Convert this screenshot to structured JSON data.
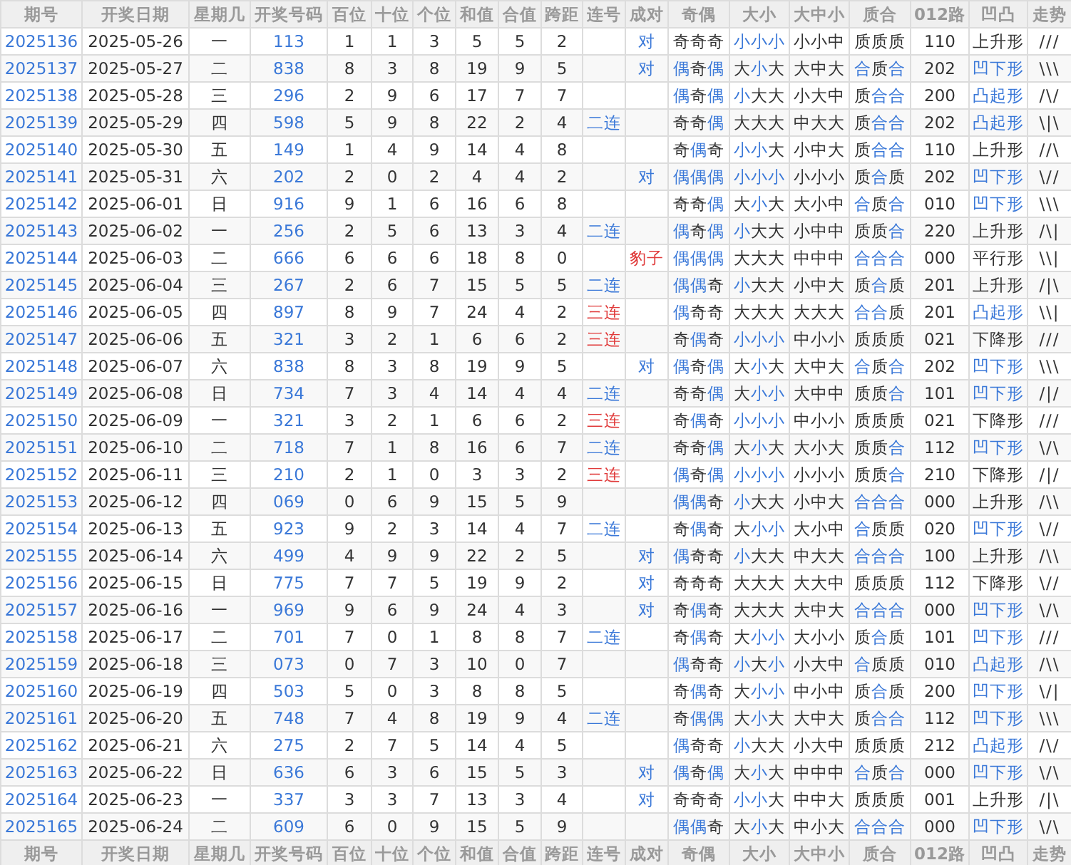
{
  "columns": [
    "期号",
    "开奖日期",
    "星期几",
    "开奖号码",
    "百位",
    "十位",
    "个位",
    "和值",
    "合值",
    "跨距",
    "连号",
    "成对",
    "奇偶",
    "大小",
    "大中小",
    "质合",
    "012路",
    "凹凸",
    "走势"
  ],
  "rows": [
    {
      "issue": "2025136",
      "date": "2025-05-26",
      "weekday": "一",
      "number": "113",
      "hundreds": "1",
      "tens": "1",
      "units": "3",
      "sum": "5",
      "sum_tail": "5",
      "span": "2",
      "pair": {
        "text": "对",
        "color": "#3a78d8"
      },
      "parity": {
        "text": "奇奇奇",
        "highlighted": [
          false,
          false,
          false
        ]
      },
      "size": {
        "text": "小小小",
        "highlighted": [
          true,
          true,
          true
        ]
      },
      "size3": "小小中",
      "prime": {
        "text": "质质质",
        "highlighted": [
          false,
          false,
          false
        ]
      },
      "road": "110",
      "shape": {
        "text": "上升形",
        "highlighted": false
      },
      "trend": "///"
    },
    {
      "issue": "2025137",
      "date": "2025-05-27",
      "weekday": "二",
      "number": "838",
      "hundreds": "8",
      "tens": "3",
      "units": "8",
      "sum": "19",
      "sum_tail": "9",
      "span": "5",
      "pair": {
        "text": "对",
        "color": "#3a78d8"
      },
      "parity": {
        "text": "偶奇偶",
        "highlighted": [
          true,
          false,
          true
        ]
      },
      "size": {
        "text": "大小大",
        "highlighted": [
          false,
          true,
          false
        ]
      },
      "size3": "大中大",
      "prime": {
        "text": "合质合",
        "highlighted": [
          true,
          false,
          true
        ]
      },
      "road": "202",
      "shape": {
        "text": "凹下形",
        "highlighted": true
      },
      "trend": "\\\\\\"
    },
    {
      "issue": "2025138",
      "date": "2025-05-28",
      "weekday": "三",
      "number": "296",
      "hundreds": "2",
      "tens": "9",
      "units": "6",
      "sum": "17",
      "sum_tail": "7",
      "span": "7",
      "parity": {
        "text": "偶奇偶",
        "highlighted": [
          true,
          false,
          true
        ]
      },
      "size": {
        "text": "小大大",
        "highlighted": [
          true,
          false,
          false
        ]
      },
      "size3": "小大中",
      "prime": {
        "text": "质合合",
        "highlighted": [
          false,
          true,
          true
        ]
      },
      "road": "200",
      "shape": {
        "text": "凸起形",
        "highlighted": true
      },
      "trend": "/\\/"
    },
    {
      "issue": "2025139",
      "date": "2025-05-29",
      "weekday": "四",
      "number": "598",
      "hundreds": "5",
      "tens": "9",
      "units": "8",
      "sum": "22",
      "sum_tail": "2",
      "span": "4",
      "consecutive": {
        "text": "二连",
        "color": "#3a78d8"
      },
      "parity": {
        "text": "奇奇偶",
        "highlighted": [
          false,
          false,
          true
        ]
      },
      "size": {
        "text": "大大大",
        "highlighted": [
          false,
          false,
          false
        ]
      },
      "size3": "中大大",
      "prime": {
        "text": "质合合",
        "highlighted": [
          false,
          true,
          true
        ]
      },
      "road": "202",
      "shape": {
        "text": "凸起形",
        "highlighted": true
      },
      "trend": "\\|\\"
    },
    {
      "issue": "2025140",
      "date": "2025-05-30",
      "weekday": "五",
      "number": "149",
      "hundreds": "1",
      "tens": "4",
      "units": "9",
      "sum": "14",
      "sum_tail": "4",
      "span": "8",
      "parity": {
        "text": "奇偶奇",
        "highlighted": [
          false,
          true,
          false
        ]
      },
      "size": {
        "text": "小小大",
        "highlighted": [
          true,
          true,
          false
        ]
      },
      "size3": "小中大",
      "prime": {
        "text": "质合合",
        "highlighted": [
          false,
          true,
          true
        ]
      },
      "road": "110",
      "shape": {
        "text": "上升形",
        "highlighted": false
      },
      "trend": "//\\"
    },
    {
      "issue": "2025141",
      "date": "2025-05-31",
      "weekday": "六",
      "number": "202",
      "hundreds": "2",
      "tens": "0",
      "units": "2",
      "sum": "4",
      "sum_tail": "4",
      "span": "2",
      "pair": {
        "text": "对",
        "color": "#3a78d8"
      },
      "parity": {
        "text": "偶偶偶",
        "highlighted": [
          true,
          true,
          true
        ]
      },
      "size": {
        "text": "小小小",
        "highlighted": [
          true,
          true,
          true
        ]
      },
      "size3": "小小小",
      "prime": {
        "text": "质合质",
        "highlighted": [
          false,
          true,
          false
        ]
      },
      "road": "202",
      "shape": {
        "text": "凹下形",
        "highlighted": true
      },
      "trend": "\\//"
    },
    {
      "issue": "2025142",
      "date": "2025-06-01",
      "weekday": "日",
      "number": "916",
      "hundreds": "9",
      "tens": "1",
      "units": "6",
      "sum": "16",
      "sum_tail": "6",
      "span": "8",
      "parity": {
        "text": "奇奇偶",
        "highlighted": [
          false,
          false,
          true
        ]
      },
      "size": {
        "text": "大小大",
        "highlighted": [
          false,
          true,
          false
        ]
      },
      "size3": "大小中",
      "prime": {
        "text": "合质合",
        "highlighted": [
          true,
          false,
          true
        ]
      },
      "road": "010",
      "shape": {
        "text": "凹下形",
        "highlighted": true
      },
      "trend": "\\\\\\"
    },
    {
      "issue": "2025143",
      "date": "2025-06-02",
      "weekday": "一",
      "number": "256",
      "hundreds": "2",
      "tens": "5",
      "units": "6",
      "sum": "13",
      "sum_tail": "3",
      "span": "4",
      "consecutive": {
        "text": "二连",
        "color": "#3a78d8"
      },
      "parity": {
        "text": "偶奇偶",
        "highlighted": [
          true,
          false,
          true
        ]
      },
      "size": {
        "text": "小大大",
        "highlighted": [
          true,
          false,
          false
        ]
      },
      "size3": "小中中",
      "prime": {
        "text": "质质合",
        "highlighted": [
          false,
          false,
          true
        ]
      },
      "road": "220",
      "shape": {
        "text": "上升形",
        "highlighted": false
      },
      "trend": "/\\|"
    },
    {
      "issue": "2025144",
      "date": "2025-06-03",
      "weekday": "二",
      "number": "666",
      "hundreds": "6",
      "tens": "6",
      "units": "6",
      "sum": "18",
      "sum_tail": "8",
      "span": "0",
      "pair": {
        "text": "豹子",
        "color": "#e03a3a"
      },
      "parity": {
        "text": "偶偶偶",
        "highlighted": [
          true,
          true,
          true
        ]
      },
      "size": {
        "text": "大大大",
        "highlighted": [
          false,
          false,
          false
        ]
      },
      "size3": "中中中",
      "prime": {
        "text": "合合合",
        "highlighted": [
          true,
          true,
          true
        ]
      },
      "road": "000",
      "shape": {
        "text": "平行形",
        "highlighted": false
      },
      "trend": "\\\\|"
    },
    {
      "issue": "2025145",
      "date": "2025-06-04",
      "weekday": "三",
      "number": "267",
      "hundreds": "2",
      "tens": "6",
      "units": "7",
      "sum": "15",
      "sum_tail": "5",
      "span": "5",
      "consecutive": {
        "text": "二连",
        "color": "#3a78d8"
      },
      "parity": {
        "text": "偶偶奇",
        "highlighted": [
          true,
          true,
          false
        ]
      },
      "size": {
        "text": "小大大",
        "highlighted": [
          true,
          false,
          false
        ]
      },
      "size3": "小中大",
      "prime": {
        "text": "质合质",
        "highlighted": [
          false,
          true,
          false
        ]
      },
      "road": "201",
      "shape": {
        "text": "上升形",
        "highlighted": false
      },
      "trend": "/|\\"
    },
    {
      "issue": "2025146",
      "date": "2025-06-05",
      "weekday": "四",
      "number": "897",
      "hundreds": "8",
      "tens": "9",
      "units": "7",
      "sum": "24",
      "sum_tail": "4",
      "span": "2",
      "consecutive": {
        "text": "三连",
        "color": "#e03a3a"
      },
      "parity": {
        "text": "偶奇奇",
        "highlighted": [
          true,
          false,
          false
        ]
      },
      "size": {
        "text": "大大大",
        "highlighted": [
          false,
          false,
          false
        ]
      },
      "size3": "大大大",
      "prime": {
        "text": "合合质",
        "highlighted": [
          true,
          true,
          false
        ]
      },
      "road": "201",
      "shape": {
        "text": "凸起形",
        "highlighted": true
      },
      "trend": "\\\\|"
    },
    {
      "issue": "2025147",
      "date": "2025-06-06",
      "weekday": "五",
      "number": "321",
      "hundreds": "3",
      "tens": "2",
      "units": "1",
      "sum": "6",
      "sum_tail": "6",
      "span": "2",
      "consecutive": {
        "text": "三连",
        "color": "#e03a3a"
      },
      "parity": {
        "text": "奇偶奇",
        "highlighted": [
          false,
          true,
          false
        ]
      },
      "size": {
        "text": "小小小",
        "highlighted": [
          true,
          true,
          true
        ]
      },
      "size3": "中小小",
      "prime": {
        "text": "质质质",
        "highlighted": [
          false,
          false,
          false
        ]
      },
      "road": "021",
      "shape": {
        "text": "下降形",
        "highlighted": false
      },
      "trend": "///"
    },
    {
      "issue": "2025148",
      "date": "2025-06-07",
      "weekday": "六",
      "number": "838",
      "hundreds": "8",
      "tens": "3",
      "units": "8",
      "sum": "19",
      "sum_tail": "9",
      "span": "5",
      "pair": {
        "text": "对",
        "color": "#3a78d8"
      },
      "parity": {
        "text": "偶奇偶",
        "highlighted": [
          true,
          false,
          true
        ]
      },
      "size": {
        "text": "大小大",
        "highlighted": [
          false,
          true,
          false
        ]
      },
      "size3": "大中大",
      "prime": {
        "text": "合质合",
        "highlighted": [
          true,
          false,
          true
        ]
      },
      "road": "202",
      "shape": {
        "text": "凹下形",
        "highlighted": true
      },
      "trend": "\\\\\\"
    },
    {
      "issue": "2025149",
      "date": "2025-06-08",
      "weekday": "日",
      "number": "734",
      "hundreds": "7",
      "tens": "3",
      "units": "4",
      "sum": "14",
      "sum_tail": "4",
      "span": "4",
      "consecutive": {
        "text": "二连",
        "color": "#3a78d8"
      },
      "parity": {
        "text": "奇奇偶",
        "highlighted": [
          false,
          false,
          true
        ]
      },
      "size": {
        "text": "大小小",
        "highlighted": [
          false,
          true,
          true
        ]
      },
      "size3": "大中中",
      "prime": {
        "text": "质质合",
        "highlighted": [
          false,
          false,
          true
        ]
      },
      "road": "101",
      "shape": {
        "text": "凹下形",
        "highlighted": true
      },
      "trend": "/|/"
    },
    {
      "issue": "2025150",
      "date": "2025-06-09",
      "weekday": "一",
      "number": "321",
      "hundreds": "3",
      "tens": "2",
      "units": "1",
      "sum": "6",
      "sum_tail": "6",
      "span": "2",
      "consecutive": {
        "text": "三连",
        "color": "#e03a3a"
      },
      "parity": {
        "text": "奇偶奇",
        "highlighted": [
          false,
          true,
          false
        ]
      },
      "size": {
        "text": "小小小",
        "highlighted": [
          true,
          true,
          true
        ]
      },
      "size3": "中小小",
      "prime": {
        "text": "质质质",
        "highlighted": [
          false,
          false,
          false
        ]
      },
      "road": "021",
      "shape": {
        "text": "下降形",
        "highlighted": false
      },
      "trend": "///"
    },
    {
      "issue": "2025151",
      "date": "2025-06-10",
      "weekday": "二",
      "number": "718",
      "hundreds": "7",
      "tens": "1",
      "units": "8",
      "sum": "16",
      "sum_tail": "6",
      "span": "7",
      "consecutive": {
        "text": "二连",
        "color": "#3a78d8"
      },
      "parity": {
        "text": "奇奇偶",
        "highlighted": [
          false,
          false,
          true
        ]
      },
      "size": {
        "text": "大小大",
        "highlighted": [
          false,
          true,
          false
        ]
      },
      "size3": "大小大",
      "prime": {
        "text": "质质合",
        "highlighted": [
          false,
          false,
          true
        ]
      },
      "road": "112",
      "shape": {
        "text": "凹下形",
        "highlighted": true
      },
      "trend": "\\/\\"
    },
    {
      "issue": "2025152",
      "date": "2025-06-11",
      "weekday": "三",
      "number": "210",
      "hundreds": "2",
      "tens": "1",
      "units": "0",
      "sum": "3",
      "sum_tail": "3",
      "span": "2",
      "consecutive": {
        "text": "三连",
        "color": "#e03a3a"
      },
      "parity": {
        "text": "偶奇偶",
        "highlighted": [
          true,
          false,
          true
        ]
      },
      "size": {
        "text": "小小小",
        "highlighted": [
          true,
          true,
          true
        ]
      },
      "size3": "小小小",
      "prime": {
        "text": "质质合",
        "highlighted": [
          false,
          false,
          true
        ]
      },
      "road": "210",
      "shape": {
        "text": "下降形",
        "highlighted": false
      },
      "trend": "/|/"
    },
    {
      "issue": "2025153",
      "date": "2025-06-12",
      "weekday": "四",
      "number": "069",
      "hundreds": "0",
      "tens": "6",
      "units": "9",
      "sum": "15",
      "sum_tail": "5",
      "span": "9",
      "parity": {
        "text": "偶偶奇",
        "highlighted": [
          true,
          true,
          false
        ]
      },
      "size": {
        "text": "小大大",
        "highlighted": [
          true,
          false,
          false
        ]
      },
      "size3": "小中大",
      "prime": {
        "text": "合合合",
        "highlighted": [
          true,
          true,
          true
        ]
      },
      "road": "000",
      "shape": {
        "text": "上升形",
        "highlighted": false
      },
      "trend": "/\\\\"
    },
    {
      "issue": "2025154",
      "date": "2025-06-13",
      "weekday": "五",
      "number": "923",
      "hundreds": "9",
      "tens": "2",
      "units": "3",
      "sum": "14",
      "sum_tail": "4",
      "span": "7",
      "consecutive": {
        "text": "二连",
        "color": "#3a78d8"
      },
      "parity": {
        "text": "奇偶奇",
        "highlighted": [
          false,
          true,
          false
        ]
      },
      "size": {
        "text": "大小小",
        "highlighted": [
          false,
          true,
          true
        ]
      },
      "size3": "大小中",
      "prime": {
        "text": "合质质",
        "highlighted": [
          true,
          false,
          false
        ]
      },
      "road": "020",
      "shape": {
        "text": "凹下形",
        "highlighted": true
      },
      "trend": "\\//"
    },
    {
      "issue": "2025155",
      "date": "2025-06-14",
      "weekday": "六",
      "number": "499",
      "hundreds": "4",
      "tens": "9",
      "units": "9",
      "sum": "22",
      "sum_tail": "2",
      "span": "5",
      "pair": {
        "text": "对",
        "color": "#3a78d8"
      },
      "parity": {
        "text": "偶奇奇",
        "highlighted": [
          true,
          false,
          false
        ]
      },
      "size": {
        "text": "小大大",
        "highlighted": [
          true,
          false,
          false
        ]
      },
      "size3": "中大大",
      "prime": {
        "text": "合合合",
        "highlighted": [
          true,
          true,
          true
        ]
      },
      "road": "100",
      "shape": {
        "text": "上升形",
        "highlighted": false
      },
      "trend": "/\\\\"
    },
    {
      "issue": "2025156",
      "date": "2025-06-15",
      "weekday": "日",
      "number": "775",
      "hundreds": "7",
      "tens": "7",
      "units": "5",
      "sum": "19",
      "sum_tail": "9",
      "span": "2",
      "pair": {
        "text": "对",
        "color": "#3a78d8"
      },
      "parity": {
        "text": "奇奇奇",
        "highlighted": [
          false,
          false,
          false
        ]
      },
      "size": {
        "text": "大大大",
        "highlighted": [
          false,
          false,
          false
        ]
      },
      "size3": "大大中",
      "prime": {
        "text": "质质质",
        "highlighted": [
          false,
          false,
          false
        ]
      },
      "road": "112",
      "shape": {
        "text": "下降形",
        "highlighted": false
      },
      "trend": "\\//"
    },
    {
      "issue": "2025157",
      "date": "2025-06-16",
      "weekday": "一",
      "number": "969",
      "hundreds": "9",
      "tens": "6",
      "units": "9",
      "sum": "24",
      "sum_tail": "4",
      "span": "3",
      "pair": {
        "text": "对",
        "color": "#3a78d8"
      },
      "parity": {
        "text": "奇偶奇",
        "highlighted": [
          false,
          true,
          false
        ]
      },
      "size": {
        "text": "大大大",
        "highlighted": [
          false,
          false,
          false
        ]
      },
      "size3": "大中大",
      "prime": {
        "text": "合合合",
        "highlighted": [
          true,
          true,
          true
        ]
      },
      "road": "000",
      "shape": {
        "text": "凹下形",
        "highlighted": true
      },
      "trend": "\\/\\"
    },
    {
      "issue": "2025158",
      "date": "2025-06-17",
      "weekday": "二",
      "number": "701",
      "hundreds": "7",
      "tens": "0",
      "units": "1",
      "sum": "8",
      "sum_tail": "8",
      "span": "7",
      "consecutive": {
        "text": "二连",
        "color": "#3a78d8"
      },
      "parity": {
        "text": "奇偶奇",
        "highlighted": [
          false,
          true,
          false
        ]
      },
      "size": {
        "text": "大小小",
        "highlighted": [
          false,
          true,
          true
        ]
      },
      "size3": "大小小",
      "prime": {
        "text": "质合质",
        "highlighted": [
          false,
          true,
          false
        ]
      },
      "road": "101",
      "shape": {
        "text": "凹下形",
        "highlighted": true
      },
      "trend": "///"
    },
    {
      "issue": "2025159",
      "date": "2025-06-18",
      "weekday": "三",
      "number": "073",
      "hundreds": "0",
      "tens": "7",
      "units": "3",
      "sum": "10",
      "sum_tail": "0",
      "span": "7",
      "parity": {
        "text": "偶奇奇",
        "highlighted": [
          true,
          false,
          false
        ]
      },
      "size": {
        "text": "小大小",
        "highlighted": [
          true,
          false,
          true
        ]
      },
      "size3": "小大中",
      "prime": {
        "text": "合质质",
        "highlighted": [
          true,
          false,
          false
        ]
      },
      "road": "010",
      "shape": {
        "text": "凸起形",
        "highlighted": true
      },
      "trend": "/\\\\"
    },
    {
      "issue": "2025160",
      "date": "2025-06-19",
      "weekday": "四",
      "number": "503",
      "hundreds": "5",
      "tens": "0",
      "units": "3",
      "sum": "8",
      "sum_tail": "8",
      "span": "5",
      "parity": {
        "text": "奇偶奇",
        "highlighted": [
          false,
          true,
          false
        ]
      },
      "size": {
        "text": "大小小",
        "highlighted": [
          false,
          true,
          true
        ]
      },
      "size3": "中小中",
      "prime": {
        "text": "质合质",
        "highlighted": [
          false,
          true,
          false
        ]
      },
      "road": "200",
      "shape": {
        "text": "凹下形",
        "highlighted": true
      },
      "trend": "\\/|"
    },
    {
      "issue": "2025161",
      "date": "2025-06-20",
      "weekday": "五",
      "number": "748",
      "hundreds": "7",
      "tens": "4",
      "units": "8",
      "sum": "19",
      "sum_tail": "9",
      "span": "4",
      "consecutive": {
        "text": "二连",
        "color": "#3a78d8"
      },
      "parity": {
        "text": "奇偶偶",
        "highlighted": [
          false,
          true,
          true
        ]
      },
      "size": {
        "text": "大小大",
        "highlighted": [
          false,
          true,
          false
        ]
      },
      "size3": "大中大",
      "prime": {
        "text": "质合合",
        "highlighted": [
          false,
          true,
          true
        ]
      },
      "road": "112",
      "shape": {
        "text": "凹下形",
        "highlighted": true
      },
      "trend": "\\\\\\"
    },
    {
      "issue": "2025162",
      "date": "2025-06-21",
      "weekday": "六",
      "number": "275",
      "hundreds": "2",
      "tens": "7",
      "units": "5",
      "sum": "14",
      "sum_tail": "4",
      "span": "5",
      "parity": {
        "text": "偶奇奇",
        "highlighted": [
          true,
          false,
          false
        ]
      },
      "size": {
        "text": "小大大",
        "highlighted": [
          true,
          false,
          false
        ]
      },
      "size3": "小大中",
      "prime": {
        "text": "质质质",
        "highlighted": [
          false,
          false,
          false
        ]
      },
      "road": "212",
      "shape": {
        "text": "凸起形",
        "highlighted": true
      },
      "trend": "/\\/"
    },
    {
      "issue": "2025163",
      "date": "2025-06-22",
      "weekday": "日",
      "number": "636",
      "hundreds": "6",
      "tens": "3",
      "units": "6",
      "sum": "15",
      "sum_tail": "5",
      "span": "3",
      "pair": {
        "text": "对",
        "color": "#3a78d8"
      },
      "parity": {
        "text": "偶奇偶",
        "highlighted": [
          true,
          false,
          true
        ]
      },
      "size": {
        "text": "大小大",
        "highlighted": [
          false,
          true,
          false
        ]
      },
      "size3": "中中中",
      "prime": {
        "text": "合质合",
        "highlighted": [
          true,
          false,
          true
        ]
      },
      "road": "000",
      "shape": {
        "text": "凹下形",
        "highlighted": true
      },
      "trend": "\\/\\"
    },
    {
      "issue": "2025164",
      "date": "2025-06-23",
      "weekday": "一",
      "number": "337",
      "hundreds": "3",
      "tens": "3",
      "units": "7",
      "sum": "13",
      "sum_tail": "3",
      "span": "4",
      "pair": {
        "text": "对",
        "color": "#3a78d8"
      },
      "parity": {
        "text": "奇奇奇",
        "highlighted": [
          false,
          false,
          false
        ]
      },
      "size": {
        "text": "小小大",
        "highlighted": [
          true,
          true,
          false
        ]
      },
      "size3": "中中大",
      "prime": {
        "text": "质质质",
        "highlighted": [
          false,
          false,
          false
        ]
      },
      "road": "001",
      "shape": {
        "text": "上升形",
        "highlighted": false
      },
      "trend": "/|\\"
    },
    {
      "issue": "2025165",
      "date": "2025-06-24",
      "weekday": "二",
      "number": "609",
      "hundreds": "6",
      "tens": "0",
      "units": "9",
      "sum": "15",
      "sum_tail": "5",
      "span": "9",
      "parity": {
        "text": "偶偶奇",
        "highlighted": [
          true,
          true,
          false
        ]
      },
      "size": {
        "text": "大小大",
        "highlighted": [
          false,
          true,
          false
        ]
      },
      "size3": "中小大",
      "prime": {
        "text": "合合合",
        "highlighted": [
          true,
          true,
          true
        ]
      },
      "road": "000",
      "shape": {
        "text": "凹下形",
        "highlighted": true
      },
      "trend": "\\/\\"
    }
  ],
  "footer_columns": [
    "期号",
    "开奖日期",
    "星期几",
    "开奖号码",
    "百位",
    "十位",
    "个位",
    "和值",
    "合值",
    "跨距",
    "连号",
    "成对",
    "奇偶",
    "大小",
    "大中小",
    "质合",
    "012路",
    "凹凸",
    "走势"
  ]
}
